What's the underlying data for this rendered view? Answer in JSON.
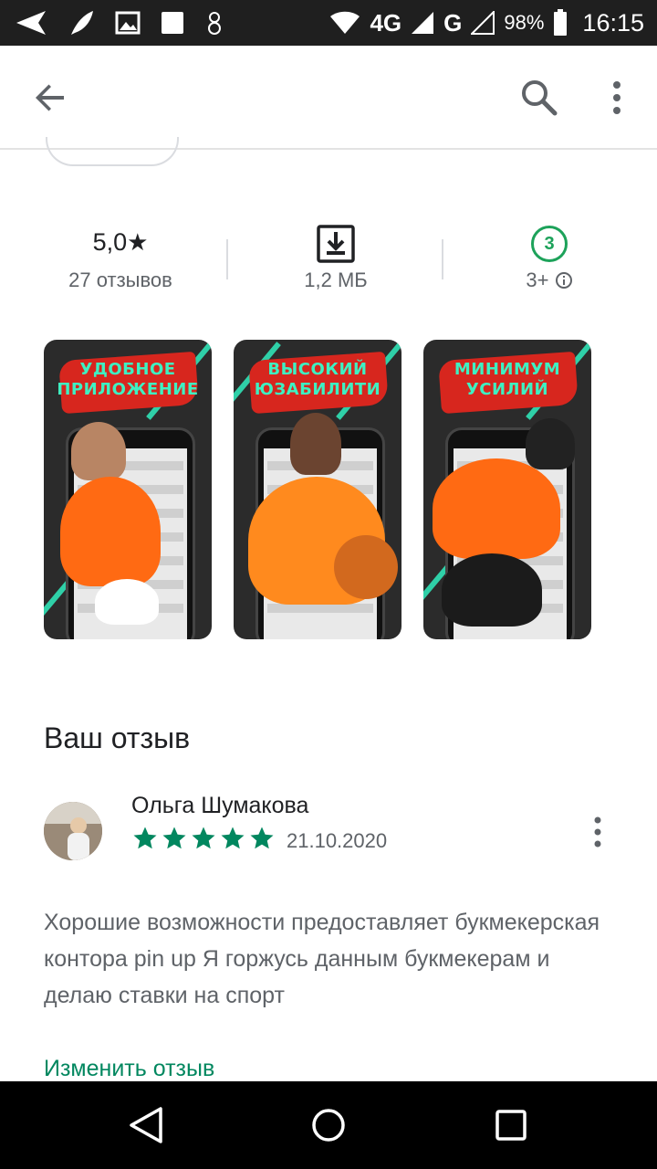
{
  "status_bar": {
    "network": "4G",
    "network2": "G",
    "battery": "98%",
    "time": "16:15"
  },
  "app_bar": {
    "icons": [
      "arrow-back-icon",
      "search-icon",
      "more-vert-icon"
    ]
  },
  "stats": {
    "rating": "5,0",
    "rating_star": "★",
    "reviews": "27 отзывов",
    "size": "1,2 МБ",
    "age_rating": "3",
    "age_label": "3+"
  },
  "screenshots": [
    {
      "line1": "УДОБНОЕ",
      "line2": "ПРИЛОЖЕНИЕ"
    },
    {
      "line1": "ВЫСОКИЙ",
      "line2": "ЮЗАБИЛИТИ"
    },
    {
      "line1": "МИНИМУМ",
      "line2": "УСИЛИЙ"
    }
  ],
  "review_section": {
    "title": "Ваш отзыв",
    "reviewer": "Ольга Шумакова",
    "stars": 5,
    "date": "21.10.2020",
    "text": "Хорошие возможности предоставляет букмекерская контора pin up Я горжусь данным букмекерам и делаю ставки на спорт",
    "edit_link": "Изменить отзыв"
  },
  "colors": {
    "accent_green": "#01875f",
    "status_bg": "#1f1f1f"
  }
}
